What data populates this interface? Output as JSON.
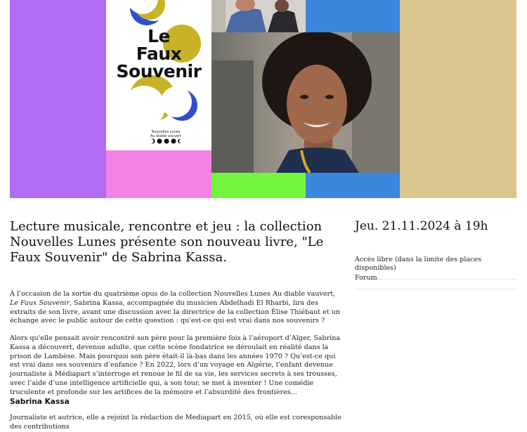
{
  "hero": {
    "cover": {
      "title_lines": [
        "Le",
        "Faux",
        "Souvenir"
      ],
      "publisher_line1": "Nouvelles Lunes",
      "publisher_line2": "Au diable vauvert"
    },
    "colors": {
      "purple": "#b06cf5",
      "pink": "#f382e6",
      "blue": "#3d86dd",
      "green": "#72f53f",
      "khaki": "#d9c48e",
      "moon_gold": "#c8b226",
      "moon_blue": "#2f4fd0"
    }
  },
  "article": {
    "headline": "Lecture musicale, rencontre et jeu : la collection Nouvelles Lunes présente son nouveau livre, \"Le Faux Souvenir\" de Sabrina Kassa.",
    "p1_before": "À l’occasion de la sortie du quatrième opus de la collection Nouvelles Lunes Au diable vauvert, ",
    "p1_italic": "Le Faux Souvenir",
    "p1_after": ", Sabrina Kassa, accompagnée du musicien Abdelhadi El Rharbi, lira des extraits de son livre, avant une discussion avec la directrice de la collection Élise Thiébaut et un échange avec le public autour de cette question : qu'est-ce qui est vrai dans nos souvenirs ?",
    "p2": "Alors qu'elle pensait avoir rencontré son père pour la première fois à l’aéroport d’Alger, Sabrina Kassa a découvert, devenue adulte, que cette scène fondatrice se déroulait en réalité dans la prison de Lambèse. Mais pourquoi son père était-il là-bas dans les années 1970 ? Qu’est-ce qui est vrai dans ses souvenirs d’enfance ? En 2022, lors d’un voyage en Algérie, l’enfant devenue journaliste à Médiapart s’interroge et renoue le fil de sa vie, les services secrets à ses trousses, avec l’aide d’une intelligence artificielle qui, à son tour, se met à inventer ! Une comédie truculente et profonde sur les artifices de la mémoire et l’absurdité des frontières...",
    "author_heading": "Sabrina Kassa",
    "p3": "Journaliste et autrice, elle a rejoint la rédaction de Mediapart en 2015, où elle est coresponsable des contributions"
  },
  "event": {
    "date": "Jeu. 21.11.2024 à 19h",
    "access": "Accès libre (dans la limite des places disponibles)",
    "venue": "Forum"
  }
}
